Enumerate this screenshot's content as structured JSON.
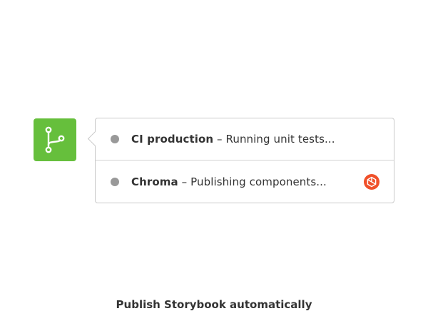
{
  "rows": [
    {
      "name": "CI production",
      "separator": " – ",
      "status": "Running unit tests..."
    },
    {
      "name": "Chroma",
      "separator": " – ",
      "status": "Publishing components..."
    }
  ],
  "caption": "Publish Storybook automatically",
  "icons": {
    "badge": "git-branch-icon",
    "status": "status-dot-icon",
    "brand": "chroma-logo-icon"
  },
  "colors": {
    "badge": "#66bf3c",
    "status_dot": "#999999",
    "brand": "#f0502a",
    "text": "#333333",
    "border": "#c9c9c9"
  }
}
